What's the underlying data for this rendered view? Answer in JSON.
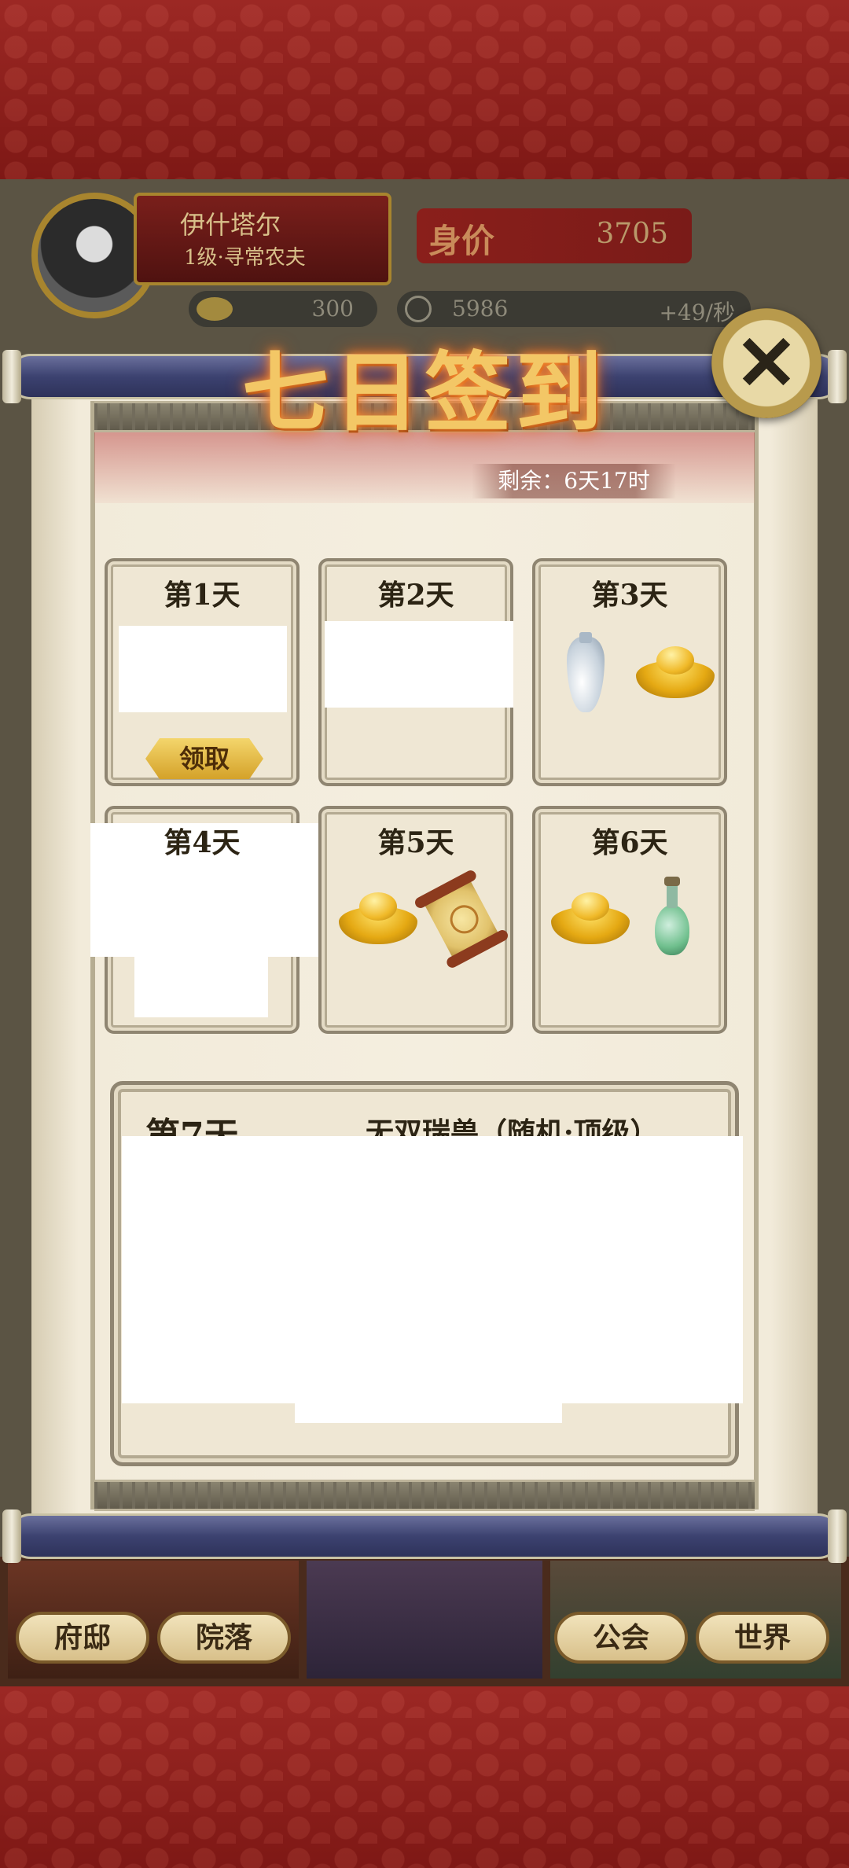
{
  "hud": {
    "player_name": "伊什塔尔",
    "player_level": "1级·寻常农夫",
    "worth_label": "身价",
    "worth_value": "3705",
    "ingots": "300",
    "coins": "5986",
    "coin_rate": "+49/秒"
  },
  "dialog": {
    "title": "七日签到",
    "remaining": "剩余：6天17时",
    "close_icon": "close-icon"
  },
  "days": [
    {
      "label": "第1天",
      "button": "领取"
    },
    {
      "label": "第2天"
    },
    {
      "label": "第3天",
      "items": [
        "vase-icon",
        "gold-ingot-icon"
      ]
    },
    {
      "label": "第4天"
    },
    {
      "label": "第5天",
      "items": [
        "gold-ingot-icon",
        "scroll-icon"
      ]
    },
    {
      "label": "第6天",
      "items": [
        "gold-ingot-icon",
        "potion-bottle-icon"
      ]
    }
  ],
  "day7": {
    "label": "第7天",
    "reward": "无双瑞兽（随机·顶级）"
  },
  "nav": {
    "mansion": "府邸",
    "courtyard": "院落",
    "guild": "公会",
    "world": "世界"
  },
  "colors": {
    "title_gold": "#f3c766",
    "roller_blue": "#3c4270",
    "paper": "#f4eedf",
    "background_red": "#8e1f1c"
  }
}
